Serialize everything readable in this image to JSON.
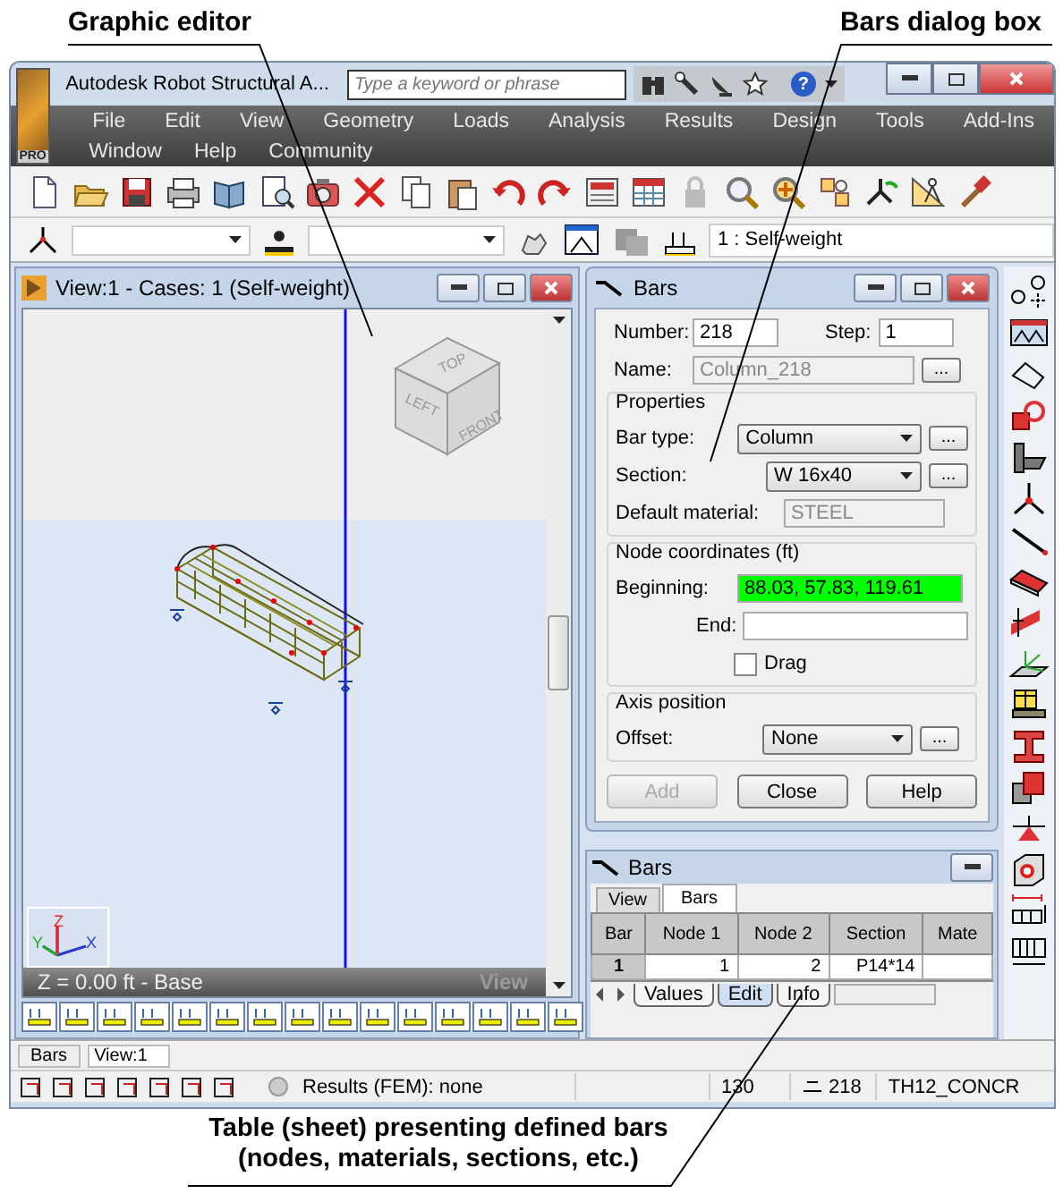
{
  "callouts": {
    "graphic_editor": "Graphic editor",
    "dialog_box": "Bars dialog box",
    "table_sheet": [
      "Table (sheet) presenting defined bars",
      "(nodes, materials, sections, etc.)"
    ]
  },
  "window": {
    "title": "Autodesk Robot Structural A...",
    "logo_badge": "PRO",
    "search": {
      "placeholder": "Type a keyword or phrase"
    },
    "help_glyph": "?"
  },
  "menu_rows": [
    [
      "File",
      "Edit",
      "View",
      "Geometry",
      "Loads",
      "Analysis",
      "Results",
      "Design",
      "Tools",
      "Add-Ins"
    ],
    [
      "Window",
      "Help",
      "Community"
    ]
  ],
  "selectors": {
    "load_case": "1 : Self-weight"
  },
  "view": {
    "title": "View:1 - Cases: 1 (Self-weight)",
    "cube_faces": {
      "top": "TOP",
      "left": "LEFT",
      "front": "FRONT"
    },
    "axes": [
      "Y",
      "Z",
      "X"
    ],
    "plane": "Z = 0.00 ft - Base",
    "mode": "View"
  },
  "bars_dialog": {
    "title": "Bars",
    "number": {
      "label": "Number:",
      "value": "218"
    },
    "step": {
      "label": "Step:",
      "value": "1"
    },
    "name": {
      "label": "Name:",
      "value": "Column_218",
      "disabled": true,
      "button": "..."
    },
    "properties": {
      "title": "Properties",
      "bar_type": {
        "label": "Bar type:",
        "value": "Column",
        "button": "..."
      },
      "section": {
        "label": "Section:",
        "value": "W 16x40",
        "button": "..."
      },
      "default_material": {
        "label": "Default material:",
        "value": "STEEL",
        "disabled": true
      }
    },
    "node_coordinates": {
      "title": "Node coordinates (ft)",
      "beginning": {
        "label": "Beginning:",
        "value": "88.03, 57.83, 119.61",
        "highlighted": true
      },
      "end": {
        "label": "End:",
        "highlighted": false
      },
      "drag": {
        "label": "Drag",
        "checked": false
      }
    },
    "axis_position": {
      "title": "Axis position",
      "offset": {
        "label": "Offset:",
        "value": "None",
        "button": "..."
      }
    },
    "buttons": [
      {
        "label": "Add",
        "disabled": true
      },
      {
        "label": "Close",
        "disabled": false
      },
      {
        "label": "Help",
        "disabled": false
      }
    ]
  },
  "bars_table": {
    "title": "Bars",
    "tabs": [
      {
        "label": "View",
        "selected": false
      },
      {
        "label": "Bars",
        "selected": true
      }
    ],
    "columns": [
      "Bar",
      "Node 1",
      "Node 2",
      "Section",
      "Mate"
    ],
    "rows": [
      {
        "cells": [
          "1",
          "1",
          "2",
          "P14*14"
        ]
      }
    ],
    "sheet_tabs": [
      {
        "label": "Values",
        "selected": false
      },
      {
        "label": "Edit",
        "selected": true
      },
      {
        "label": "Info",
        "selected": false
      }
    ]
  },
  "document_tabs": [
    {
      "label": "Bars",
      "selected": false
    },
    {
      "label": "View:1",
      "selected": true
    }
  ],
  "status_bar": {
    "results": "Results (FEM): none",
    "node_count": "130",
    "bar_number": "218",
    "material": "TH12_CONCR"
  }
}
